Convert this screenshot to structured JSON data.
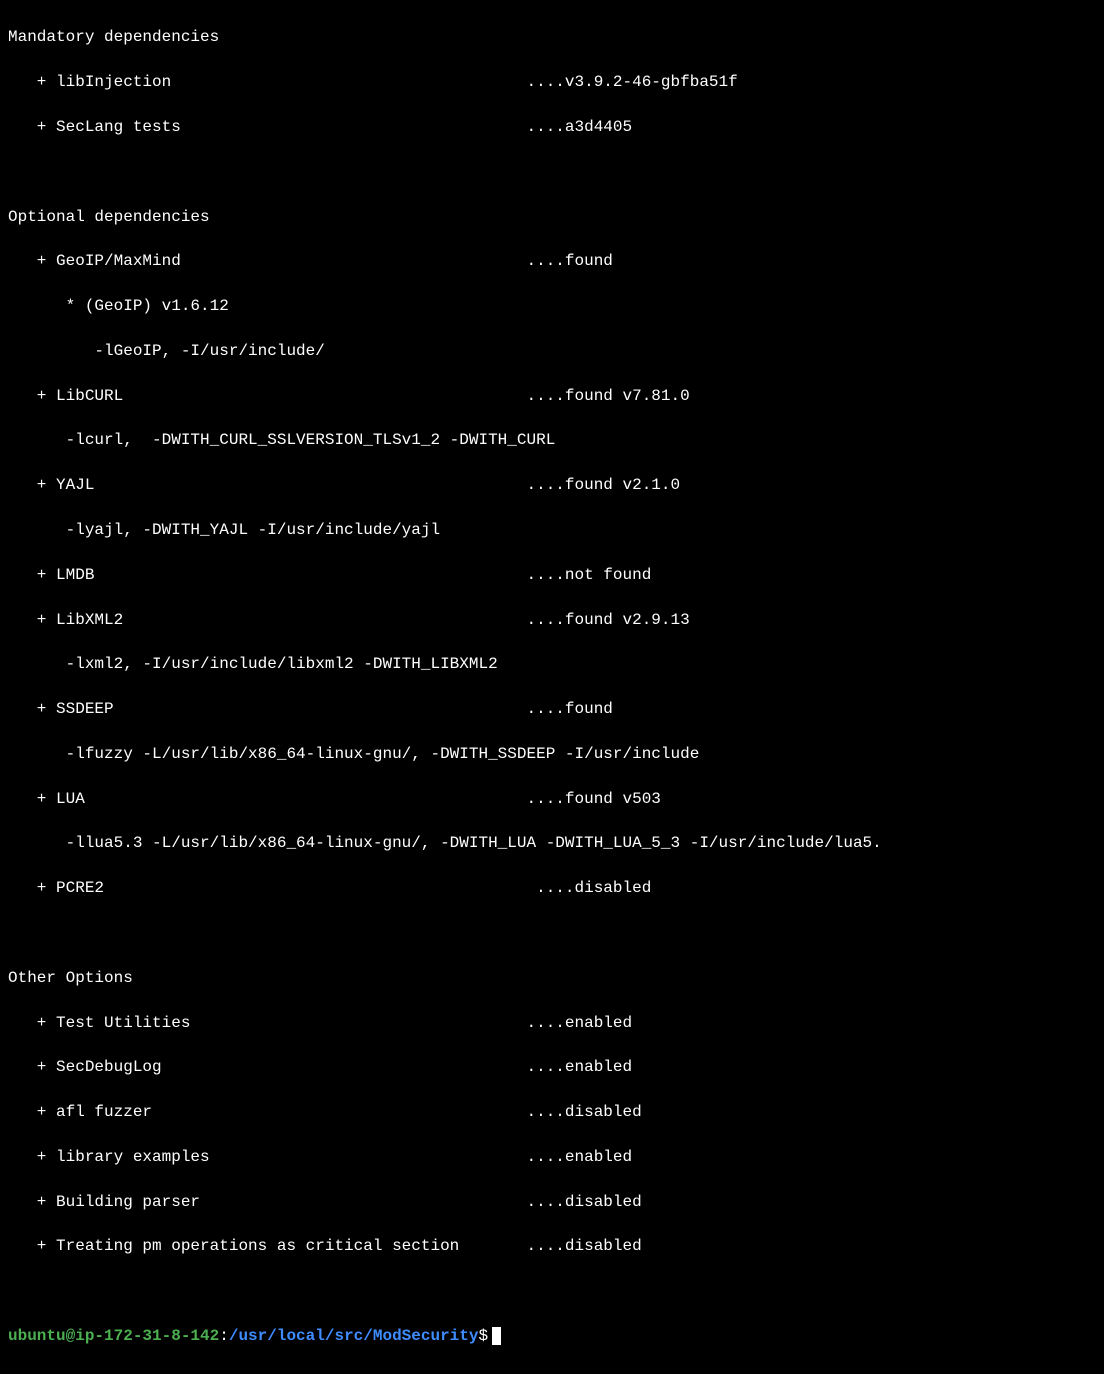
{
  "headers": {
    "mandatory": "Mandatory dependencies",
    "optional": "Optional dependencies",
    "other": "Other Options"
  },
  "mandatory": {
    "libinjection": {
      "text": "   + libInjection                                     ....v3.9.2-46-gbfba51f"
    },
    "seclang": {
      "text": "   + SecLang tests                                    ....a3d4405"
    }
  },
  "optional": {
    "geoip": {
      "text": "   + GeoIP/MaxMind                                    ....found "
    },
    "geoip_ver": {
      "text": "      * (GeoIP) v1.6.12"
    },
    "geoip_flag": {
      "text": "         -lGeoIP, -I/usr/include/"
    },
    "libcurl": {
      "text": "   + LibCURL                                          ....found v7.81.0 "
    },
    "libcurl_f": {
      "text": "      -lcurl,  -DWITH_CURL_SSLVERSION_TLSv1_2 -DWITH_CURL"
    },
    "yajl": {
      "text": "   + YAJL                                             ....found v2.1.0"
    },
    "yajl_f": {
      "text": "      -lyajl, -DWITH_YAJL -I/usr/include/yajl"
    },
    "lmdb": {
      "text": "   + LMDB                                             ....not found"
    },
    "libxml2": {
      "text": "   + LibXML2                                          ....found v2.9.13"
    },
    "libxml2_f": {
      "text": "      -lxml2, -I/usr/include/libxml2 -DWITH_LIBXML2"
    },
    "ssdeep": {
      "text": "   + SSDEEP                                           ....found "
    },
    "ssdeep_f": {
      "text": "      -lfuzzy -L/usr/lib/x86_64-linux-gnu/, -DWITH_SSDEEP -I/usr/include"
    },
    "lua": {
      "text": "   + LUA                                              ....found v503"
    },
    "lua_f": {
      "text": "      -llua5.3 -L/usr/lib/x86_64-linux-gnu/, -DWITH_LUA -DWITH_LUA_5_3 -I/usr/include/lua5."
    },
    "pcre2": {
      "text": "   + PCRE2                                             ....disabled"
    }
  },
  "other": {
    "test_util": {
      "text": "   + Test Utilities                                   ....enabled"
    },
    "secdebug": {
      "text": "   + SecDebugLog                                      ....enabled"
    },
    "afl": {
      "text": "   + afl fuzzer                                       ....disabled"
    },
    "examples": {
      "text": "   + library examples                                 ....enabled"
    },
    "parser": {
      "text": "   + Building parser                                  ....disabled"
    },
    "pm": {
      "text": "   + Treating pm operations as critical section       ....disabled"
    }
  },
  "prompt": {
    "userhost": "ubuntu@ip-172-31-8-142",
    "colon": ":",
    "path": "/usr/local/src/ModSecurity",
    "dollar": "$"
  }
}
